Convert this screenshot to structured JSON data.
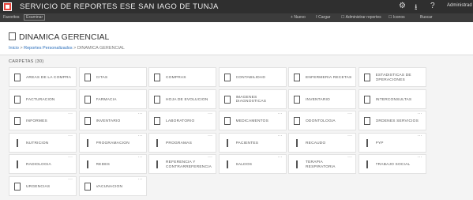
{
  "topbar": {
    "title": "SERVICIO DE REPORTES ESE SAN IAGO DE TUNJA",
    "settings_icon": "gear-icon",
    "download_icon": "download-icon",
    "help_icon": "question-icon",
    "user": "Administrad"
  },
  "subbar": {
    "left_items": [
      "Favoritos",
      "Examinar"
    ],
    "new_label": "Nuevo",
    "upload_label": "Cargar",
    "manage_label": "Administrar reportes",
    "view_label": "Iconos",
    "search_placeholder": "Buscar"
  },
  "header": {
    "title": "DINAMICA GERENCIAL",
    "breadcrumb_home": "Inicio",
    "breadcrumb_parent": "Reportes Personalizados",
    "breadcrumb_current": "DINAMICA GERENCIAL"
  },
  "section_label": "CARPETAS (30)",
  "tiles": [
    {
      "label": "AREAS DE LA COMPRA",
      "icon": "folder-icon",
      "dots": false
    },
    {
      "label": "CITAS",
      "icon": "folder-icon",
      "dots": false
    },
    {
      "label": "COMPRAS",
      "icon": "folder-icon",
      "dots": false
    },
    {
      "label": "CONTABILIDAD",
      "icon": "folder-icon",
      "dots": false
    },
    {
      "label": "ENFERMERIA RECETAS",
      "icon": "folder-icon",
      "dots": false
    },
    {
      "label": "ESTADISTICAS DE OPERACIONES",
      "icon": "folder-icon",
      "dots": false
    },
    {
      "label": "FACTURACION",
      "icon": "folder-icon",
      "dots": false
    },
    {
      "label": "FARMACIA",
      "icon": "folder-icon",
      "dots": false
    },
    {
      "label": "HOJA DE EVOLUCION",
      "icon": "folder-icon",
      "dots": false
    },
    {
      "label": "IMAGENES DIAGNOSTICAS",
      "icon": "folder-icon",
      "dots": false
    },
    {
      "label": "INVENTARIO",
      "icon": "folder-icon",
      "dots": false
    },
    {
      "label": "INTERCONSULTAS",
      "icon": "folder-icon",
      "dots": false
    },
    {
      "label": "INFORMES",
      "icon": "folder-icon",
      "dots": true
    },
    {
      "label": "INVENTARIO",
      "icon": "folder-icon",
      "dots": true
    },
    {
      "label": "LABORATORIO",
      "icon": "folder-icon",
      "dots": true
    },
    {
      "label": "MEDICAMENTOS",
      "icon": "folder-icon",
      "dots": true
    },
    {
      "label": "ODONTOLOGIA",
      "icon": "folder-icon",
      "dots": true
    },
    {
      "label": "ORDENES SERVICIOS",
      "icon": "folder-icon",
      "dots": true
    },
    {
      "label": "NUTRICION",
      "icon": "report-icon",
      "dots": true
    },
    {
      "label": "PROGRAMACION",
      "icon": "report-icon",
      "dots": true
    },
    {
      "label": "PROGRAMAS",
      "icon": "report-icon",
      "dots": true
    },
    {
      "label": "PACIENTES",
      "icon": "report-icon",
      "dots": true
    },
    {
      "label": "RECAUDO",
      "icon": "report-icon",
      "dots": true
    },
    {
      "label": "PYP",
      "icon": "report-icon",
      "dots": true
    },
    {
      "label": "RADIOLOGIA",
      "icon": "report-icon",
      "dots": true
    },
    {
      "label": "REDES",
      "icon": "report-icon",
      "dots": true
    },
    {
      "label": "REFERENCIA Y CONTRARREFERENCIA",
      "icon": "report-icon",
      "dots": true
    },
    {
      "label": "SALDOS",
      "icon": "report-icon",
      "dots": true
    },
    {
      "label": "TERAPIA RESPIRATORIA",
      "icon": "report-icon",
      "dots": true
    },
    {
      "label": "TRABAJO SOCIAL",
      "icon": "report-icon",
      "dots": true
    },
    {
      "label": "URGENCIAS",
      "icon": "folder-icon",
      "dots": true
    },
    {
      "label": "VACUNACION",
      "icon": "folder-icon",
      "dots": true
    }
  ],
  "colors": {
    "topbar": "#2f2f2f",
    "logo": "#e8453c",
    "link": "#2a6ebb"
  }
}
